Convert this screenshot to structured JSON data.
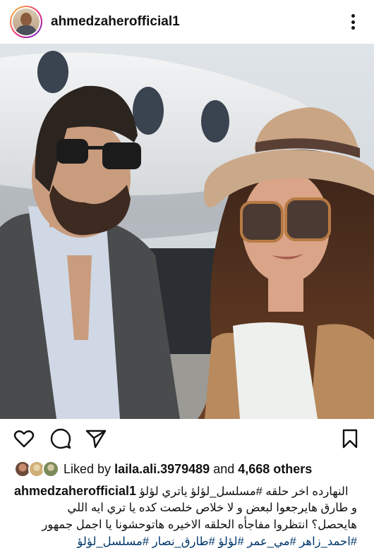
{
  "post": {
    "username": "ahmedzaherofficial1"
  },
  "icons": {
    "more": "more-vertical-icon",
    "like": "heart-icon",
    "comment": "comment-icon",
    "share": "send-icon",
    "save": "bookmark-icon"
  },
  "likes": {
    "prefix": "Liked by",
    "user": "laila.ali.3979489",
    "and": "and",
    "others": "4,668 others"
  },
  "caption": {
    "username": "ahmedzaherofficial1",
    "line1": "النهارده اخر حلقه #مسلسل_لؤلؤ ياتري لؤلؤ",
    "line2": "و طارق هايرجعوا لبعض و لا خلاص خلصت كده يا تري ايه اللي",
    "line3": "هايحصل؟ انتظروا مفاجأه الحلقه الاخيره هاتوحشونا يا اجمل جمهور",
    "line4": "#احمد_زاهر #مي_عمر #لؤلؤ #طارق_نصار #مسلسل_لؤلؤ"
  },
  "colors": {
    "link": "#00376b",
    "text": "#111111",
    "story_ring_start": "#f9ce34",
    "story_ring_end": "#6228d7"
  }
}
